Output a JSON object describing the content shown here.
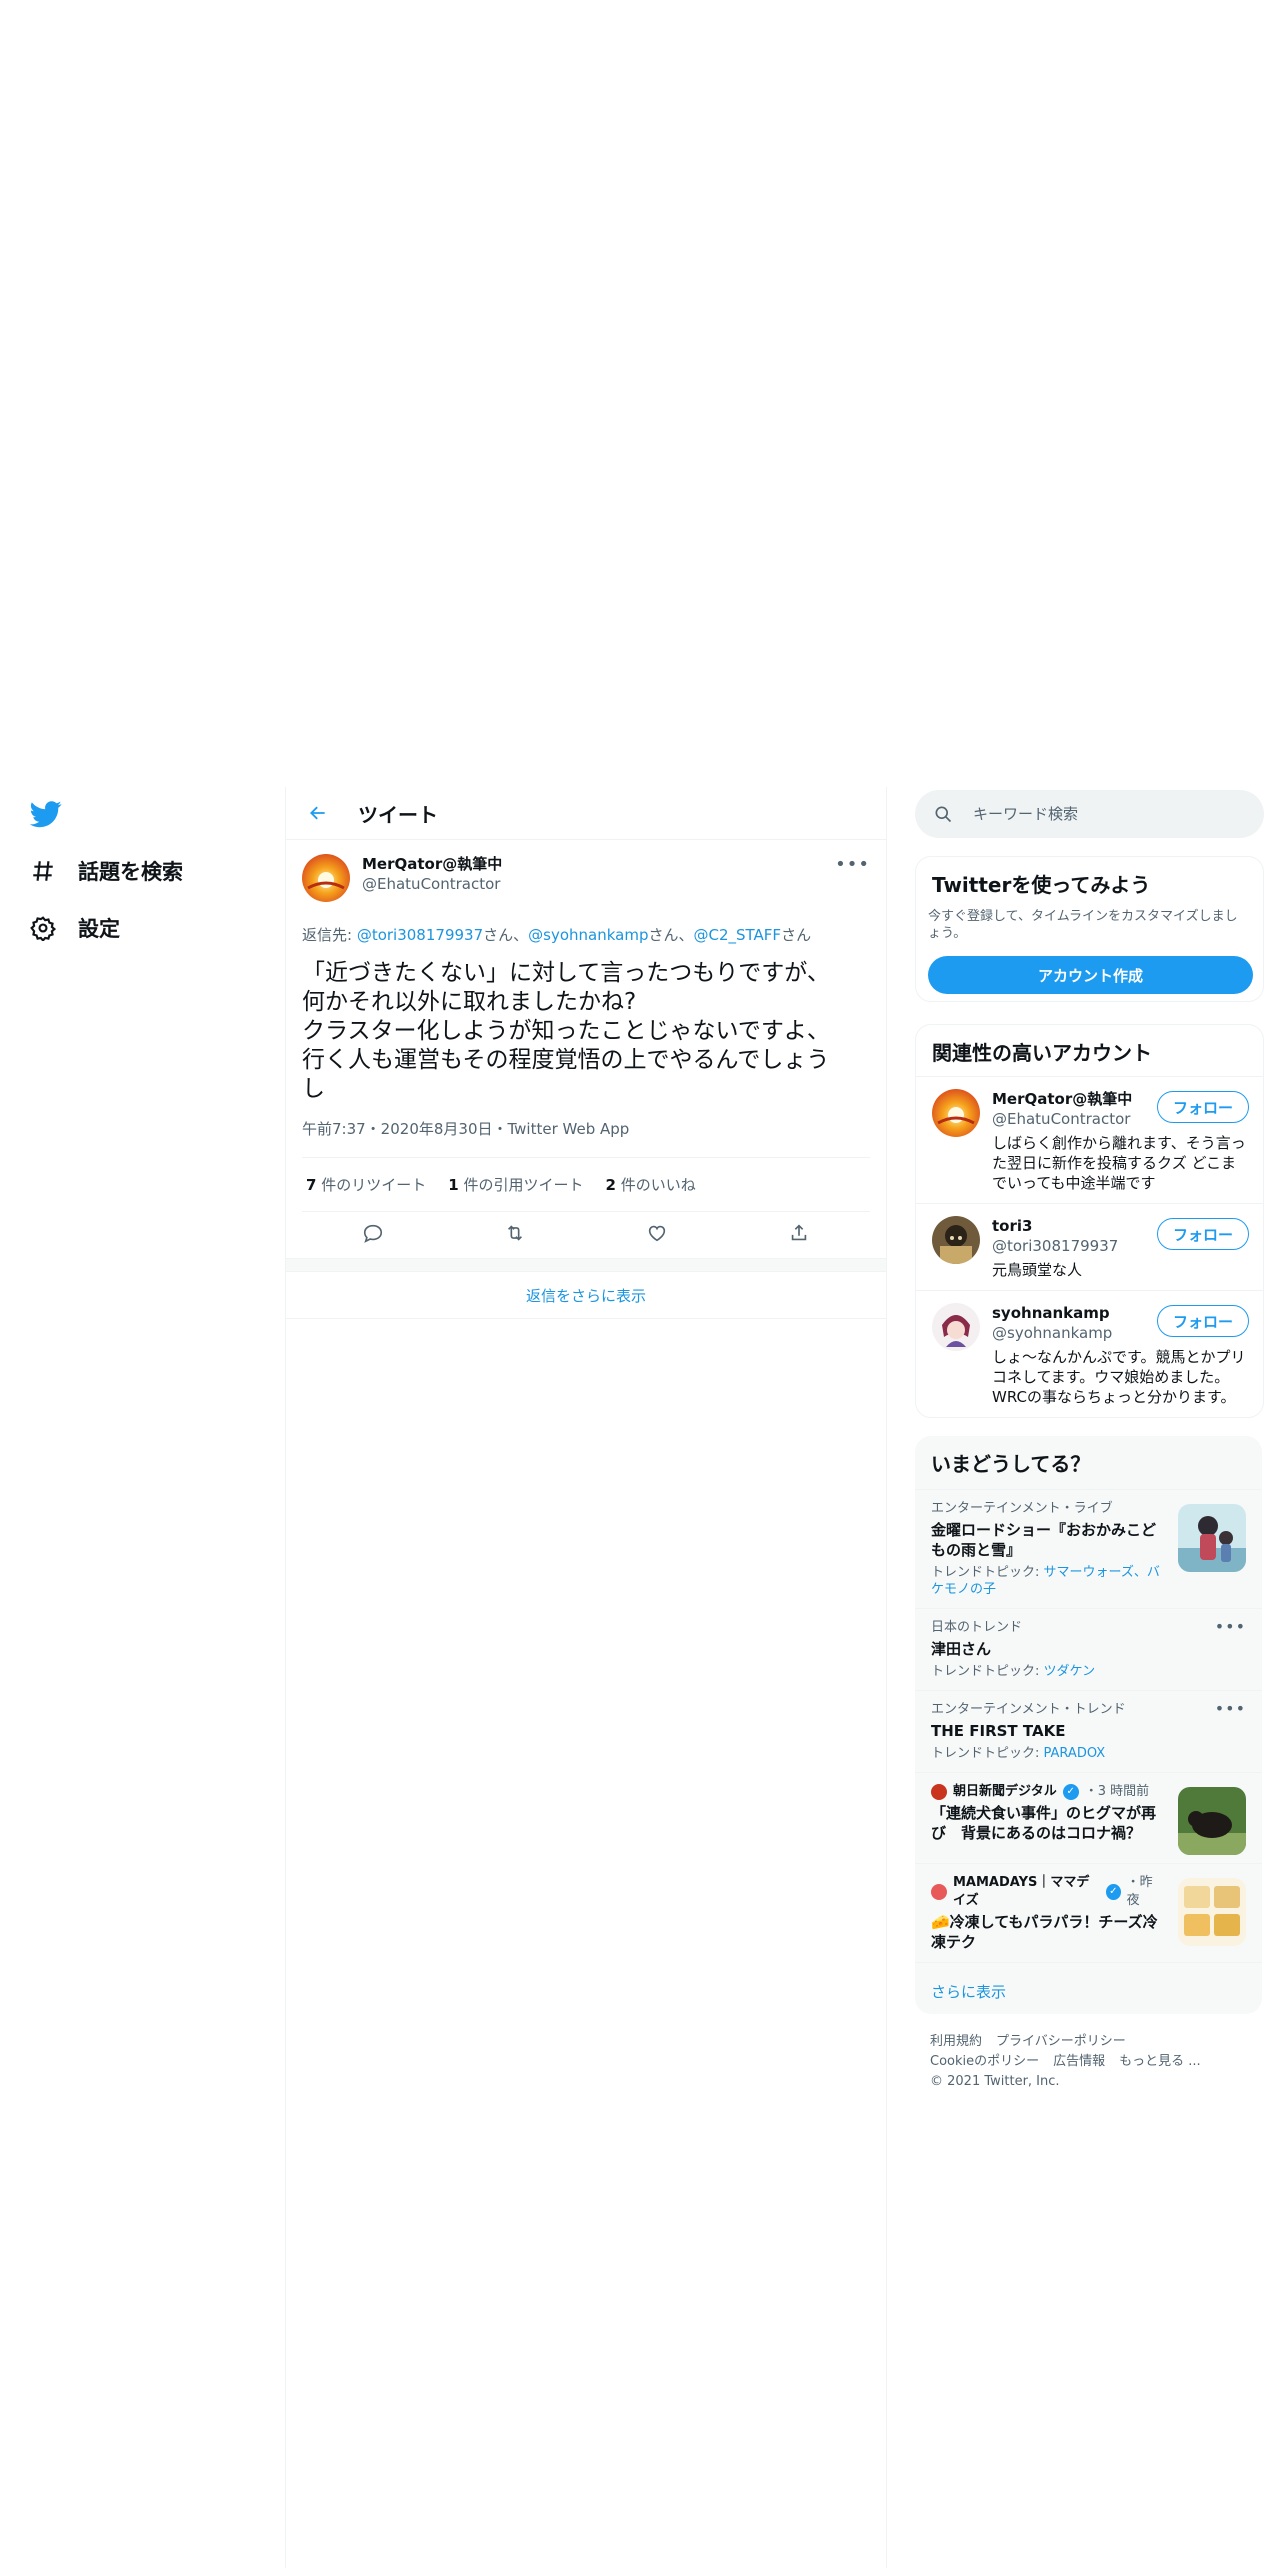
{
  "nav": {
    "items": [
      {
        "label": "話題を検索",
        "icon": "hashtag-icon"
      },
      {
        "label": "設定",
        "icon": "gear-icon"
      }
    ]
  },
  "header": {
    "title": "ツイート"
  },
  "tweet": {
    "author_name": "MerQator@執筆中",
    "author_handle": "@EhatuContractor",
    "reply_prefix": "返信先: ",
    "reply_mentions": [
      "@tori308179937",
      "@syohnankamp",
      "@C2_STAFF"
    ],
    "reply_suffix": "さん",
    "reply_sep": "さん、",
    "text": "「近づきたくない」に対して言ったつもりですが、\n何かそれ以外に取れましたかね?\nクラスター化しようが知ったことじゃないですよ、\n行く人も運営もその程度覚悟の上でやるんでしょう\nし",
    "timestamp": "午前7:37・2020年8月30日・Twitter Web App",
    "retweets": {
      "count": "7",
      "label": "件のリツイート"
    },
    "quotes": {
      "count": "1",
      "label": "件の引用ツイート"
    },
    "likes": {
      "count": "2",
      "label": "件のいいね"
    }
  },
  "show_more_replies": "返信をさらに表示",
  "search": {
    "placeholder": "キーワード検索"
  },
  "signup": {
    "title": "Twitterを使ってみよう",
    "desc": "今すぐ登録して、タイムラインをカスタマイズしましょう。",
    "button": "アカウント作成"
  },
  "related": {
    "title": "関連性の高いアカウント",
    "follow_label": "フォロー",
    "accounts": [
      {
        "name": "MerQator@執筆中",
        "handle": "@EhatuContractor",
        "bio": "しばらく創作から離れます、そう言った翌日に新作を投稿するクズ どこまでいっても中途半端です"
      },
      {
        "name": "tori3",
        "handle": "@tori308179937",
        "bio": "元鳥頭堂な人"
      },
      {
        "name": "syohnankamp",
        "handle": "@syohnankamp",
        "bio": "しょ～なんかんぷです。競馬とかプリコネしてます。ウマ娘始めました。WRCの事ならちょっと分かります。"
      }
    ]
  },
  "trends": {
    "title": "いまどうしてる？",
    "topics_prefix": "トレンドトピック: ",
    "items": [
      {
        "meta": "エンターテインメント・ライブ",
        "title": "金曜ロードショー『おおかみこどもの雨と雪』",
        "topics": "サマーウォーズ、バケモノの子"
      },
      {
        "meta": "日本のトレンド",
        "title": "津田さん",
        "topics": "ツダケン"
      },
      {
        "meta": "エンターテインメント・トレンド",
        "title": "THE FIRST TAKE",
        "topics": "PARADOX"
      }
    ],
    "news": [
      {
        "source": "朝日新聞デジタル",
        "time": "・3 時間前",
        "title": "「連続犬食い事件」のヒグマが再び　背景にあるのはコロナ禍？"
      },
      {
        "source": "MAMADAYS｜ママデイズ",
        "time": "・昨夜",
        "title": "🧀冷凍してもパラパラ！チーズ冷凍テク"
      }
    ],
    "more": "さらに表示"
  },
  "footer": {
    "links": [
      "利用規約",
      "プライバシーポリシー",
      "Cookieのポリシー",
      "広告情報",
      "もっと見る ..."
    ],
    "copyright": "© 2021 Twitter, Inc."
  },
  "colors": {
    "accent": "#1d9bf0",
    "link": "#1b95e0",
    "secondary_text": "#536471",
    "border": "#eff3f4"
  }
}
